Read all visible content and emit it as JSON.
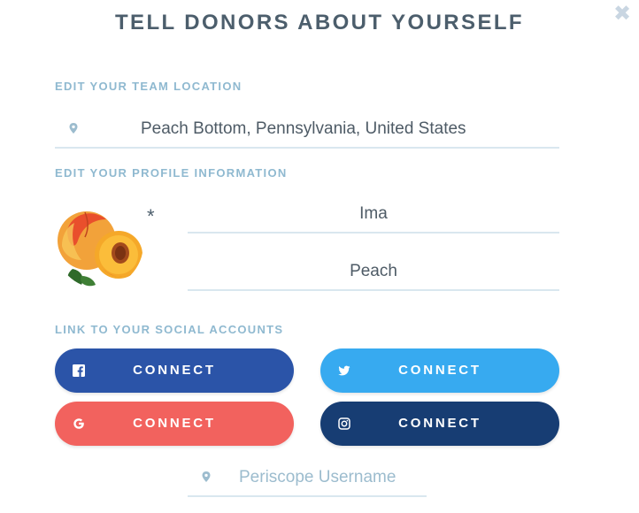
{
  "modal": {
    "title": "TELL DONORS ABOUT YOURSELF",
    "close_icon": "close-icon"
  },
  "location": {
    "section_label": "EDIT YOUR TEAM LOCATION",
    "value": "Peach Bottom, Pennsylvania, United States",
    "icon": "map-pin-icon"
  },
  "profile": {
    "section_label": "EDIT YOUR PROFILE INFORMATION",
    "avatar": "peach-avatar",
    "required_marker": "*",
    "first_name": "Ima",
    "last_name": "Peach"
  },
  "social": {
    "section_label": "LINK TO YOUR SOCIAL ACCOUNTS",
    "buttons": [
      {
        "network": "facebook",
        "label": "CONNECT",
        "icon": "facebook-icon",
        "color": "#2b54a8"
      },
      {
        "network": "twitter",
        "label": "CONNECT",
        "icon": "twitter-icon",
        "color": "#37aaf0"
      },
      {
        "network": "google",
        "label": "CONNECT",
        "icon": "google-icon",
        "color": "#f2625e"
      },
      {
        "network": "instagram",
        "label": "CONNECT",
        "icon": "instagram-icon",
        "color": "#173d73"
      }
    ],
    "periscope": {
      "placeholder": "Periscope Username",
      "icon": "map-pin-icon"
    }
  },
  "colors": {
    "title": "#4c5e6c",
    "section_label": "#8fb9d0",
    "field_underline": "#d9e7ef",
    "field_text": "#4e5b66",
    "placeholder": "#9cbcce"
  }
}
